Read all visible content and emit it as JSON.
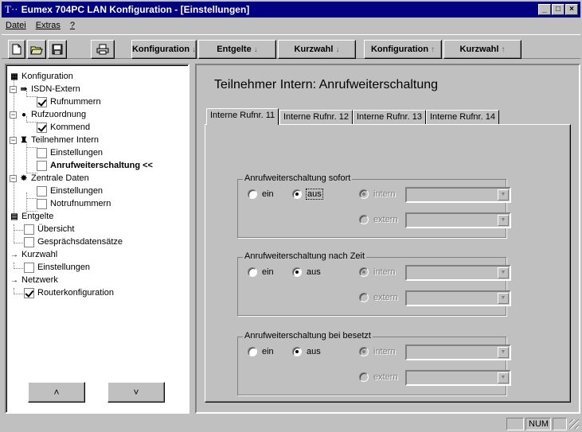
{
  "window": {
    "logo": "T··",
    "title": "Eumex 704PC LAN Konfiguration - [Einstellungen]"
  },
  "menu": [
    {
      "label": "Datei"
    },
    {
      "label": "Extras"
    },
    {
      "label": "?"
    }
  ],
  "toolbar": {
    "nav_buttons": [
      {
        "label": "Konfiguration",
        "arrow": "↓"
      },
      {
        "label": "Entgelte",
        "arrow": "↓"
      },
      {
        "label": "Kurzwahl",
        "arrow": "↓"
      },
      {
        "label": "Konfiguration",
        "arrow": "↑"
      },
      {
        "label": "Kurzwahl",
        "arrow": "↑"
      }
    ]
  },
  "tree": {
    "items": [
      {
        "label": "Konfiguration"
      },
      {
        "label": "ISDN-Extern"
      },
      {
        "label": "Rufnummern",
        "checked": true
      },
      {
        "label": "Rufzuordnung"
      },
      {
        "label": "Kommend",
        "checked": true
      },
      {
        "label": "Teilnehmer Intern"
      },
      {
        "label": "Einstellungen",
        "checked": false
      },
      {
        "label": "Anrufweiterschaltung <<",
        "checked": false
      },
      {
        "label": "Zentrale Daten"
      },
      {
        "label": "Einstellungen",
        "checked": false
      },
      {
        "label": "Notrufnummern",
        "checked": false
      },
      {
        "label": "Entgelte"
      },
      {
        "label": "Übersicht",
        "checked": false
      },
      {
        "label": "Gesprächsdatensätze",
        "checked": false
      },
      {
        "label": "Kurzwahl"
      },
      {
        "label": "Einstellungen",
        "checked": false
      },
      {
        "label": "Netzwerk"
      },
      {
        "label": "Routerkonfiguration",
        "checked": true
      }
    ],
    "up_button": "˄",
    "down_button": "˅"
  },
  "main": {
    "heading": "Teilnehmer Intern: Anrufweiterschaltung",
    "tabs": [
      {
        "label": "Interne Rufnr. 11"
      },
      {
        "label": "Interne Rufnr. 12"
      },
      {
        "label": "Interne Rufnr. 13"
      },
      {
        "label": "Interne Rufnr. 14"
      }
    ],
    "active_tab": "Interne Rufnr. 11",
    "groups": [
      {
        "title": "Anrufweiterschaltung sofort",
        "on_label": "ein",
        "off_label": "aus",
        "selected": "aus",
        "intern_label": "intern",
        "extern_label": "extern",
        "intern_value": "",
        "extern_value": ""
      },
      {
        "title": "Anrufweiterschaltung nach Zeit",
        "on_label": "ein",
        "off_label": "aus",
        "selected": "aus",
        "intern_label": "intern",
        "extern_label": "extern",
        "intern_value": "",
        "extern_value": ""
      },
      {
        "title": "Anrufweiterschaltung bei besetzt",
        "on_label": "ein",
        "off_label": "aus",
        "selected": "aus",
        "intern_label": "intern",
        "extern_label": "extern",
        "intern_value": "",
        "extern_value": ""
      }
    ]
  },
  "status": {
    "num": "NUM"
  }
}
